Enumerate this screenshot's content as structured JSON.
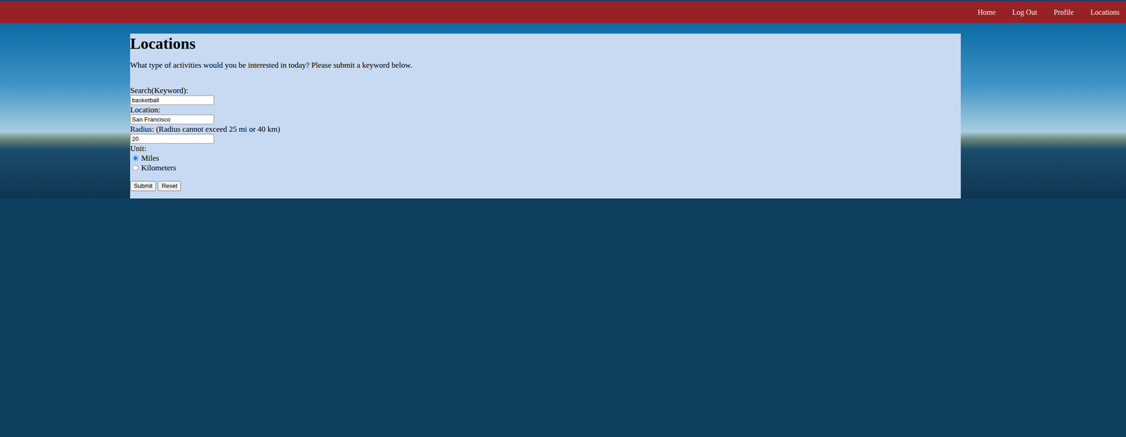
{
  "nav": {
    "links": [
      "Home",
      "Log Out",
      "Profile",
      "Locations"
    ]
  },
  "panel": {
    "title": "Locations",
    "prompt": "What type of activities would you be interested in today? Please submit a keyword below.",
    "fields": [
      {
        "label": "Search(Keyword):",
        "value": "basketball"
      },
      {
        "label": "Location:",
        "value": "San Francisco"
      },
      {
        "label": "Radius: (Radius cannot exceed 25 mi or 40 km)",
        "value": "20"
      }
    ],
    "unit": {
      "label": "Unit:",
      "options": [
        {
          "label": "Miles",
          "selected": true
        },
        {
          "label": "Kilometers",
          "selected": false
        }
      ]
    },
    "buttons": [
      "Submit",
      "Reset"
    ]
  }
}
